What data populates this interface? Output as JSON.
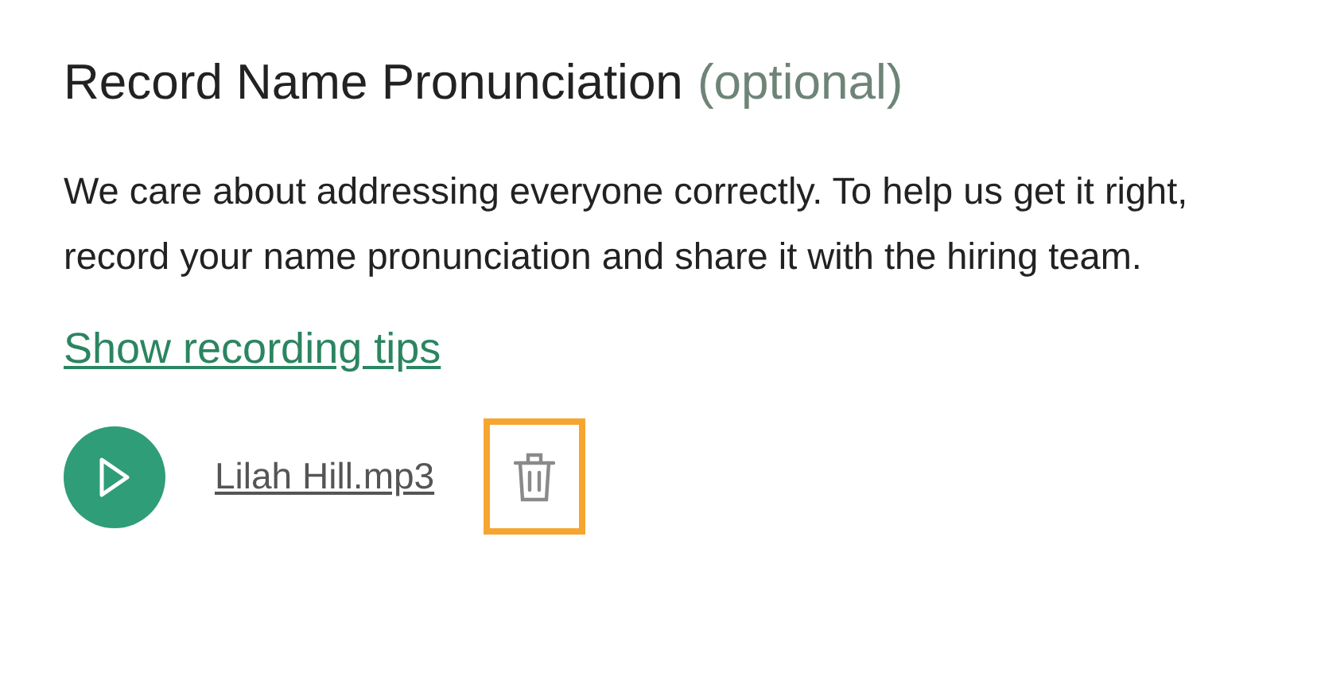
{
  "heading": {
    "title": "Record Name Pronunciation",
    "note": "(optional)"
  },
  "description": "We care about addressing everyone correctly. To help us get it right, record your name pronunciation and share it with the hiring team.",
  "tips_link": "Show recording tips",
  "recording": {
    "file_name": "Lilah Hill.mp3",
    "delete_focused": true
  }
}
